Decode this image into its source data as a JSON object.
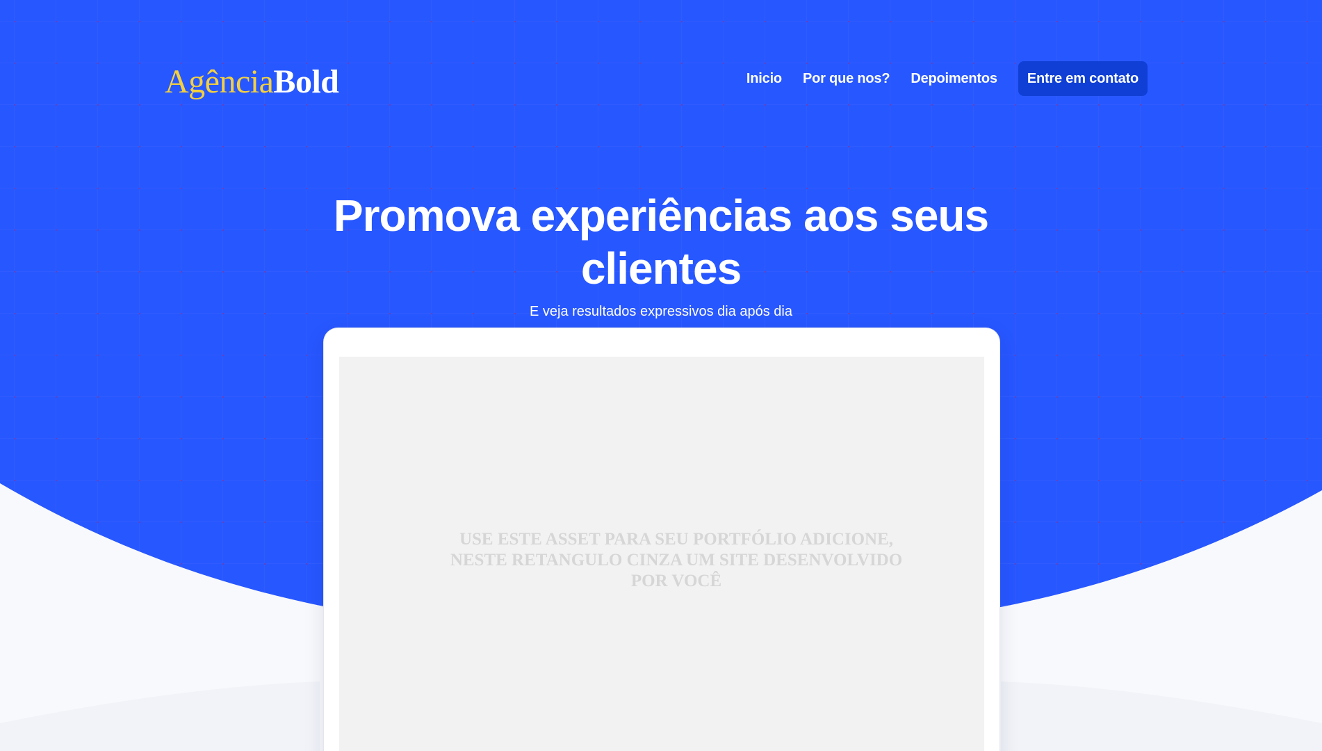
{
  "brand": {
    "name_part1": "Agência",
    "name_part2": "Bold",
    "accent_color": "#f4d03f"
  },
  "nav": {
    "items": [
      {
        "label": "Inicio"
      },
      {
        "label": "Por que nos?"
      },
      {
        "label": "Depoimentos"
      }
    ],
    "cta_label": "Entre em contato"
  },
  "hero": {
    "title": "Promova experiências aos seus clientes",
    "subtitle": "E veja resultados expressivos dia após dia",
    "background_color": "#2757ff",
    "cta_color": "#0f3fd4"
  },
  "mockup": {
    "placeholder_text": "USE ESTE ASSET PARA SEU PORTFÓLIO ADICIONE, NESTE RETANGULO CINZA UM SITE DESENVOLVIDO POR VOCÊ"
  }
}
